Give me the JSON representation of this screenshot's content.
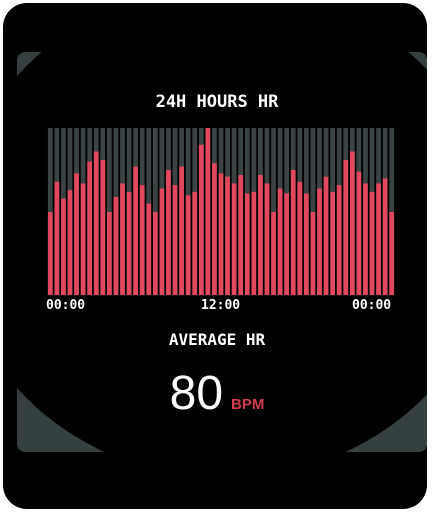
{
  "screen": {
    "title": "24H HOURS HR",
    "average_label": "AVERAGE HR",
    "average_value": "80",
    "average_unit": "BPM"
  },
  "colors": {
    "bar": "#e2485e",
    "bar_stroke": "#ff6f80",
    "track": "#3a4444",
    "accent": "#cf3c4e",
    "screen_bg": "#354040"
  },
  "chart_data": {
    "type": "bar",
    "title": "24H HOURS HR",
    "xlabel": "",
    "ylabel": "",
    "x_tick_labels": [
      "00:00",
      "12:00",
      "00:00"
    ],
    "ylim": [
      0,
      1
    ],
    "values": [
      0.5,
      0.68,
      0.58,
      0.63,
      0.73,
      0.67,
      0.8,
      0.86,
      0.81,
      0.5,
      0.59,
      0.67,
      0.62,
      0.77,
      0.66,
      0.55,
      0.5,
      0.64,
      0.75,
      0.66,
      0.77,
      0.6,
      0.62,
      0.9,
      1.0,
      0.79,
      0.73,
      0.71,
      0.67,
      0.72,
      0.61,
      0.62,
      0.72,
      0.67,
      0.5,
      0.64,
      0.61,
      0.75,
      0.68,
      0.61,
      0.5,
      0.64,
      0.71,
      0.62,
      0.66,
      0.81,
      0.86,
      0.74,
      0.67,
      0.62,
      0.67,
      0.7,
      0.5
    ]
  }
}
